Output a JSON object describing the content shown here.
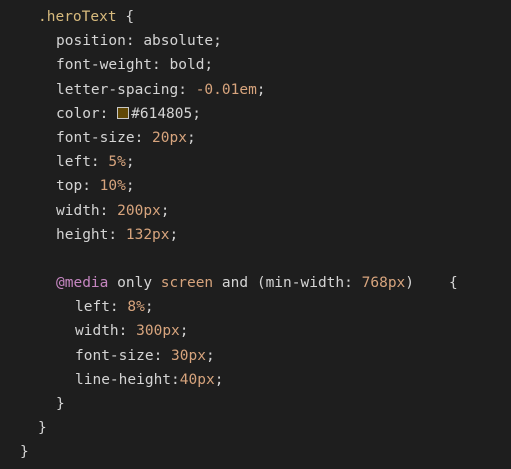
{
  "code": {
    "selector": ".heroText",
    "open_brace": "{",
    "rules": [
      {
        "prop": "position",
        "value": "absolute",
        "type": "text"
      },
      {
        "prop": "font-weight",
        "value": "bold",
        "type": "text"
      },
      {
        "prop": "letter-spacing",
        "value": "-0.01em",
        "type": "num"
      },
      {
        "prop": "color",
        "value": "#614805",
        "type": "color",
        "swatch": "#614805"
      },
      {
        "prop": "font-size",
        "value": "20px",
        "type": "num"
      },
      {
        "prop": "left",
        "value": "5%",
        "type": "num"
      },
      {
        "prop": "top",
        "value": "10%",
        "type": "num"
      },
      {
        "prop": "width",
        "value": "200px",
        "type": "num"
      },
      {
        "prop": "height",
        "value": "132px",
        "type": "num"
      }
    ],
    "media": {
      "at": "@media",
      "only": "only",
      "screen": "screen",
      "and": "and",
      "query_open": "(",
      "query_prop": "min-width",
      "query_value": "768px",
      "query_close": ")",
      "open_brace": "{",
      "rules": [
        {
          "prop": "left",
          "value": "8%",
          "sep": ": "
        },
        {
          "prop": "width",
          "value": "300px",
          "sep": ": "
        },
        {
          "prop": "font-size",
          "value": "30px",
          "sep": ": "
        },
        {
          "prop": "line-height",
          "value": "40px",
          "sep": ":"
        }
      ],
      "close_brace": "}"
    },
    "inner_close_brace": "}",
    "outer_close_brace": "}"
  }
}
